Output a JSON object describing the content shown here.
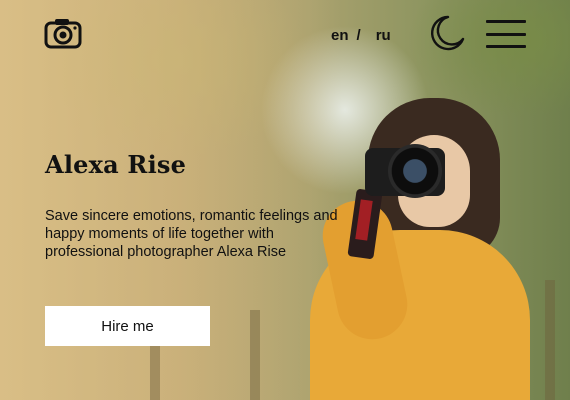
{
  "header": {
    "logo_icon": "camera-icon",
    "lang_en": "en",
    "lang_separator": "/",
    "lang_ru": "ru",
    "theme_icon": "moon-icon",
    "menu_icon": "hamburger-menu-icon"
  },
  "hero": {
    "title": "Alexa Rise",
    "description": "Save sincere emotions, romantic feelings and happy moments of life together with professional photographer Alexa Rise",
    "button_label": "Hire me"
  },
  "colors": {
    "text": "#111111",
    "button_bg": "#ffffff",
    "sweater": "#e8a938"
  }
}
